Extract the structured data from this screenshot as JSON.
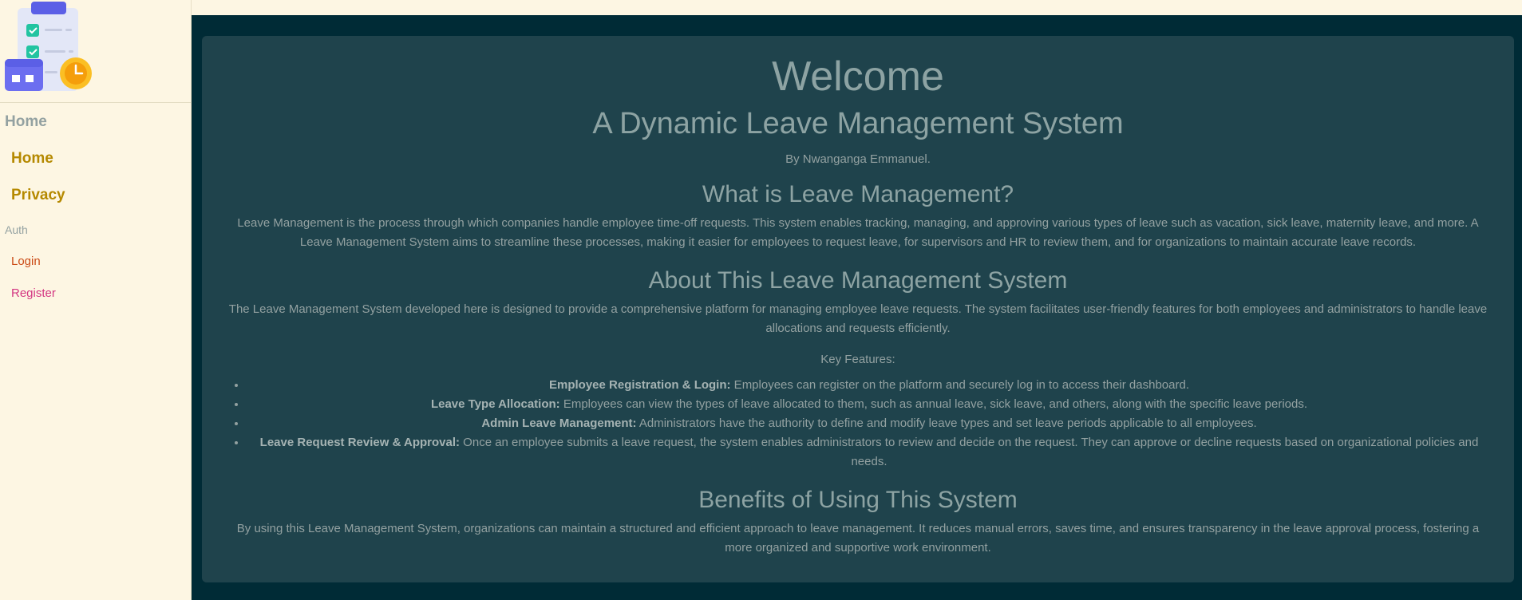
{
  "sidebar": {
    "heading": "Home",
    "items": [
      {
        "label": "Home"
      },
      {
        "label": "Privacy"
      }
    ],
    "auth_heading": "Auth",
    "auth_items": [
      {
        "label": "Login"
      },
      {
        "label": "Register"
      }
    ]
  },
  "main": {
    "title": "Welcome",
    "subtitle": "A Dynamic Leave Management System",
    "byline": "By Nwanganga Emmanuel.",
    "sections": [
      {
        "heading": "What is Leave Management?",
        "text": "Leave Management is the process through which companies handle employee time-off requests. This system enables tracking, managing, and approving various types of leave such as vacation, sick leave, maternity leave, and more. A Leave Management System aims to streamline these processes, making it easier for employees to request leave, for supervisors and HR to review them, and for organizations to maintain accurate leave records."
      },
      {
        "heading": "About This Leave Management System",
        "text": "The Leave Management System developed here is designed to provide a comprehensive platform for managing employee leave requests. The system facilitates user-friendly features for both employees and administrators to handle leave allocations and requests efficiently."
      }
    ],
    "features_label": "Key Features:",
    "features": [
      {
        "title": "Employee Registration & Login:",
        "text": " Employees can register on the platform and securely log in to access their dashboard."
      },
      {
        "title": "Leave Type Allocation:",
        "text": " Employees can view the types of leave allocated to them, such as annual leave, sick leave, and others, along with the specific leave periods."
      },
      {
        "title": "Admin Leave Management:",
        "text": " Administrators have the authority to define and modify leave types and set leave periods applicable to all employees."
      },
      {
        "title": "Leave Request Review & Approval:",
        "text": " Once an employee submits a leave request, the system enables administrators to review and decide on the request. They can approve or decline requests based on organizational policies and needs."
      }
    ],
    "benefits": {
      "heading": "Benefits of Using This System",
      "text": "By using this Leave Management System, organizations can maintain a structured and efficient approach to leave management. It reduces manual errors, saves time, and ensures transparency in the leave approval process, fostering a more organized and supportive work environment."
    }
  },
  "colors": {
    "sidebar_bg": "#fdf6e3",
    "main_bg": "#002b36",
    "card_bg": "#1f434c",
    "nav_link": "#b58900",
    "login_link": "#cb4b16",
    "register_link": "#d33682",
    "text": "#93a1a1"
  },
  "icons": {
    "logo": "leave-checklist-calendar-clock-logo"
  }
}
